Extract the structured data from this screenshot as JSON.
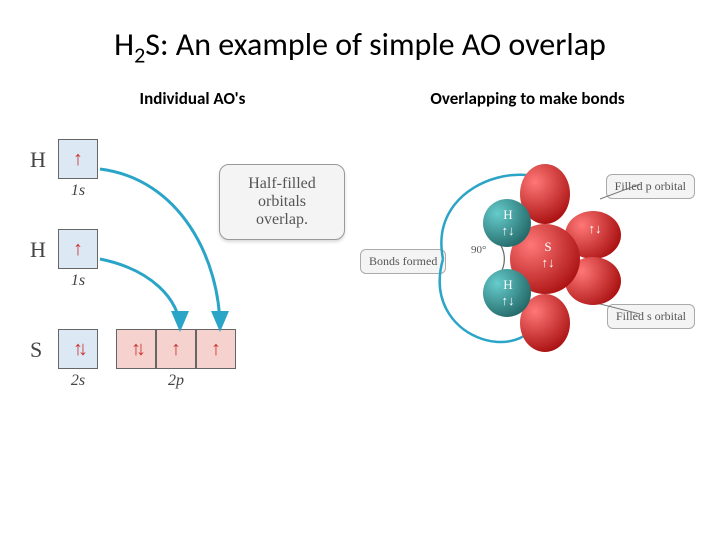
{
  "title_prefix": "H",
  "title_sub": "2",
  "title_rest": "S:  An example of simple AO overlap",
  "left": {
    "heading": "Individual AO's",
    "rows": [
      {
        "atom": "H",
        "groups": [
          {
            "boxes": [
              {
                "fill": "↑",
                "cls": "blue"
              }
            ],
            "sub": "1s"
          }
        ]
      },
      {
        "atom": "H",
        "groups": [
          {
            "boxes": [
              {
                "fill": "↑",
                "cls": "blue"
              }
            ],
            "sub": "1s"
          }
        ]
      },
      {
        "atom": "S",
        "groups": [
          {
            "boxes": [
              {
                "fill": "↑↓",
                "cls": "blue"
              }
            ],
            "sub": "2s"
          },
          {
            "boxes": [
              {
                "fill": "↑↓",
                "cls": "pink"
              },
              {
                "fill": "↑",
                "cls": "pink"
              },
              {
                "fill": "↑",
                "cls": "pink"
              }
            ],
            "sub": "2p"
          }
        ]
      }
    ],
    "callout": "Half-filled orbitals overlap."
  },
  "right": {
    "heading": "Overlapping to make bonds",
    "labels": {
      "bonds_formed": "Bonds formed",
      "angle": "90°",
      "filled_p": "Filled p orbital",
      "filled_s": "Filled s orbital"
    },
    "atom_labels": {
      "H": "H",
      "S": "S"
    },
    "spin": "↑↓"
  }
}
